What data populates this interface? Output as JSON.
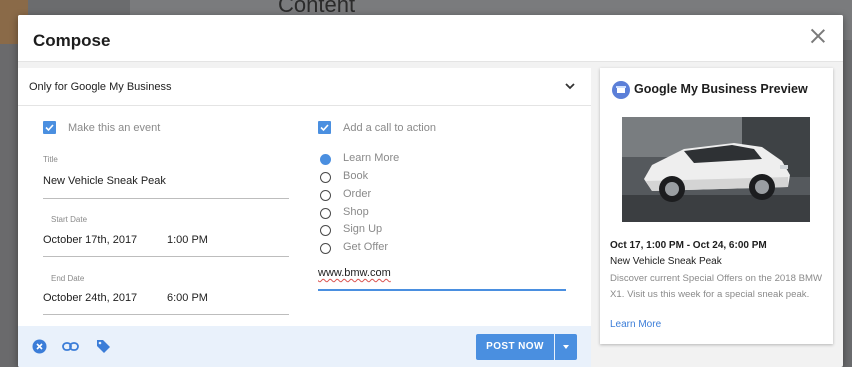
{
  "background": {
    "heading": "Content"
  },
  "dialog": {
    "title": "Compose"
  },
  "form": {
    "post_type_select": "Only for Google My Business",
    "event_checkbox_label": "Make this an event",
    "event_checked": true,
    "title_label": "Title",
    "title_value": "New Vehicle Sneak Peak",
    "start_date_label": "Start Date",
    "start_date_value": "October 17th, 2017",
    "start_time_value": "1:00 PM",
    "end_date_label": "End Date",
    "end_date_value": "October 24th, 2017",
    "end_time_value": "6:00 PM",
    "cta_checkbox_label": "Add a call to action",
    "cta_checked": true,
    "cta_options": [
      "Learn More",
      "Book",
      "Order",
      "Shop",
      "Sign Up",
      "Get Offer"
    ],
    "cta_selected": "Learn More",
    "url_value": "www.bmw.com"
  },
  "footer": {
    "icons": [
      "close-circle-icon",
      "link-icon",
      "tag-icon"
    ],
    "post_now_label": "POST NOW"
  },
  "preview": {
    "title": "Google My Business Preview",
    "image": "white-bmw-x1-car-photo",
    "date_range": "Oct 17, 1:00 PM - Oct 24, 6:00 PM",
    "event_name": "New Vehicle Sneak Peak",
    "description": "Discover current Special Offers on the 2018 BMW X1. Visit us this week for a special sneak peak.",
    "cta_link": "Learn More"
  },
  "colors": {
    "accent": "#4a8fe0",
    "link": "#3b7dd8",
    "footer_bg": "#e9f1fb"
  }
}
